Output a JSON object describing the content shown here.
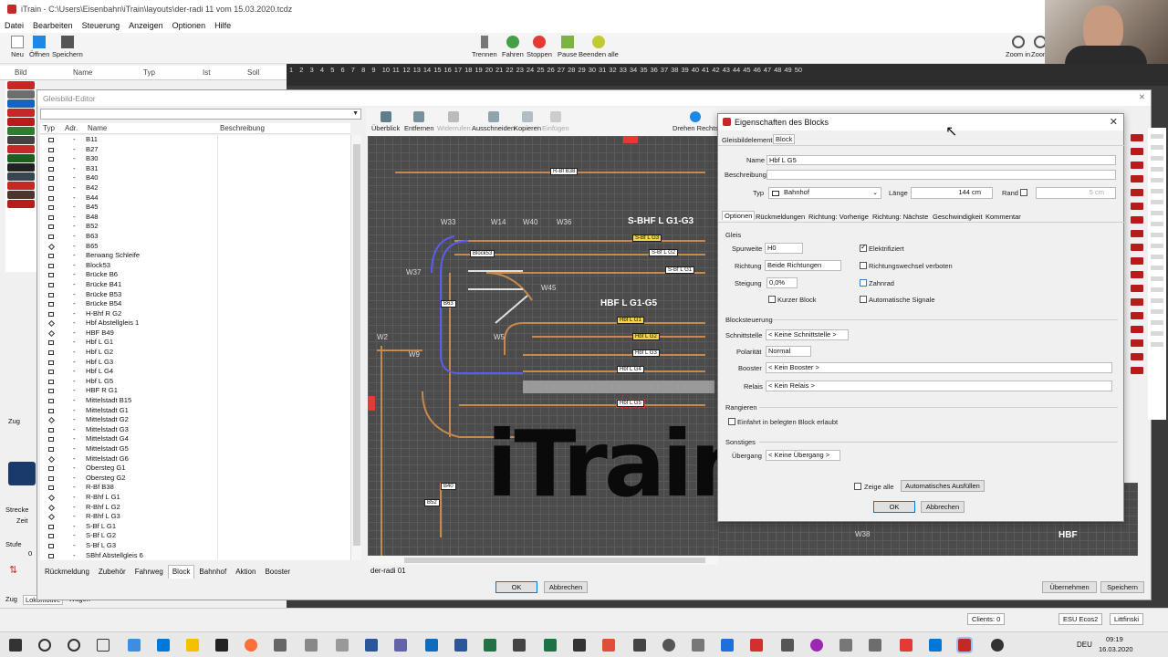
{
  "window": {
    "title": "iTrain - C:\\Users\\Eisenbahn\\iTrain\\layouts\\der-radi 11 vom 15.03.2020.tcdz"
  },
  "menu": [
    "Datei",
    "Bearbeiten",
    "Steuerung",
    "Anzeigen",
    "Optionen",
    "Hilfe"
  ],
  "toolbar": {
    "new": "Neu",
    "open": "Öffnen",
    "save": "Speichern",
    "separate": "Trennen",
    "drive": "Fahren",
    "stop": "Stoppen",
    "pause": "Pause",
    "end_all": "Beenden alle",
    "zoom_in": "Zoom in",
    "zoom_out": "Zoom"
  },
  "loco_header": {
    "bild": "Bild",
    "name": "Name",
    "typ": "Typ",
    "ist": "Ist",
    "soll": "Soll"
  },
  "ruler": [
    "1",
    "2",
    "3",
    "4",
    "5",
    "6",
    "7",
    "8",
    "9",
    "10",
    "11",
    "12",
    "13",
    "14",
    "15",
    "16",
    "17",
    "18",
    "19",
    "20",
    "21",
    "22",
    "23",
    "24",
    "25",
    "26",
    "27",
    "28",
    "29",
    "30",
    "31",
    "32",
    "33",
    "34",
    "35",
    "36",
    "37",
    "38",
    "39",
    "40",
    "41",
    "42",
    "43",
    "44",
    "45",
    "46",
    "47",
    "48",
    "49",
    "50"
  ],
  "editor": {
    "title": "Gleisbild-Editor",
    "columns": {
      "typ": "Typ",
      "adr": "Adr.",
      "name": "Name",
      "desc": "Beschreibung"
    },
    "rows": [
      {
        "t": "b",
        "a": "-",
        "n": "B11"
      },
      {
        "t": "b",
        "a": "-",
        "n": "B27"
      },
      {
        "t": "b",
        "a": "-",
        "n": "B30"
      },
      {
        "t": "b",
        "a": "-",
        "n": "B31"
      },
      {
        "t": "b",
        "a": "-",
        "n": "B40"
      },
      {
        "t": "b",
        "a": "-",
        "n": "B42"
      },
      {
        "t": "b",
        "a": "-",
        "n": "B44"
      },
      {
        "t": "b",
        "a": "-",
        "n": "B45"
      },
      {
        "t": "b",
        "a": "-",
        "n": "B48"
      },
      {
        "t": "b",
        "a": "-",
        "n": "B52"
      },
      {
        "t": "b",
        "a": "-",
        "n": "B63"
      },
      {
        "t": "d",
        "a": "-",
        "n": "B65"
      },
      {
        "t": "b",
        "a": "-",
        "n": "Berwang Schleife"
      },
      {
        "t": "b",
        "a": "-",
        "n": "Block53"
      },
      {
        "t": "b",
        "a": "-",
        "n": "Brücke B6"
      },
      {
        "t": "b",
        "a": "-",
        "n": "Brücke B41"
      },
      {
        "t": "b",
        "a": "-",
        "n": "Brücke B53"
      },
      {
        "t": "b",
        "a": "-",
        "n": "Brücke B54"
      },
      {
        "t": "b",
        "a": "-",
        "n": "H-Bhf R G2"
      },
      {
        "t": "d",
        "a": "-",
        "n": "Hbf Abstellgleis 1"
      },
      {
        "t": "d",
        "a": "-",
        "n": "HBF B49"
      },
      {
        "t": "b",
        "a": "-",
        "n": "Hbf L G1"
      },
      {
        "t": "b",
        "a": "-",
        "n": "Hbf L G2"
      },
      {
        "t": "b",
        "a": "-",
        "n": "Hbf L G3"
      },
      {
        "t": "b",
        "a": "-",
        "n": "Hbf L G4"
      },
      {
        "t": "b",
        "a": "-",
        "n": "Hbf L G5"
      },
      {
        "t": "b",
        "a": "-",
        "n": "HBF R G1"
      },
      {
        "t": "b",
        "a": "-",
        "n": "Mittelstadt B15"
      },
      {
        "t": "b",
        "a": "-",
        "n": "Mittelstadt G1"
      },
      {
        "t": "d",
        "a": "-",
        "n": "Mittelstadt G2"
      },
      {
        "t": "b",
        "a": "-",
        "n": "Mittelstadt G3"
      },
      {
        "t": "b",
        "a": "-",
        "n": "Mittelstadt G4"
      },
      {
        "t": "b",
        "a": "-",
        "n": "Mittelstadt G5"
      },
      {
        "t": "d",
        "a": "-",
        "n": "Mittelstadt G6"
      },
      {
        "t": "b",
        "a": "-",
        "n": "Obersteg G1"
      },
      {
        "t": "b",
        "a": "-",
        "n": "Obersteg G2"
      },
      {
        "t": "b",
        "a": "-",
        "n": "R-Bf B38"
      },
      {
        "t": "d",
        "a": "-",
        "n": "R-Bhf L G1"
      },
      {
        "t": "d",
        "a": "-",
        "n": "R-Bhf L G2"
      },
      {
        "t": "d",
        "a": "-",
        "n": "R-Bhf L G3"
      },
      {
        "t": "b",
        "a": "-",
        "n": "S-Bf L G1"
      },
      {
        "t": "b",
        "a": "-",
        "n": "S-Bf L G2"
      },
      {
        "t": "b",
        "a": "-",
        "n": "S-Bf L G3"
      },
      {
        "t": "b",
        "a": "-",
        "n": "SBhf Abstellgleis 6"
      }
    ],
    "tabs": [
      "Rückmeldung",
      "Zubehör",
      "Fahrweg",
      "Block",
      "Bahnhof",
      "Aktion",
      "Booster"
    ],
    "tools": {
      "overview": "Überblick",
      "remove": "Entfernen",
      "undo": "Widerrufen",
      "cut": "Ausschneiden",
      "copy": "Kopieren",
      "paste": "Einfügen",
      "rotate": "Drehen Rechts"
    },
    "layout_tab": "der-radi 01",
    "ok": "OK",
    "cancel": "Abbrechen",
    "apply": "Übernehmen",
    "save": "Speichern"
  },
  "canvas": {
    "labels": {
      "w33": "W33",
      "w14": "W14",
      "w40": "W40",
      "w36": "W36",
      "w37": "W37",
      "w45": "W45",
      "w5": "W5",
      "w9": "W9",
      "w2": "W2",
      "w38": "W38"
    },
    "big": {
      "sbhf": "S-BHF L G1-G3",
      "hbf": "HBF L G1-G5",
      "hbf2": "HBF"
    },
    "blocks": {
      "rbf": "R-Bf B38",
      "block53": "Block53",
      "b63": "B63",
      "b40": "B40",
      "b52": "B52",
      "sbf3": "S-Bf L G3",
      "sbf2": "S-Bf L G2",
      "sbf1": "S-Bf L G1",
      "hg1": "Hbf L G1",
      "hg2": "Hbf L G2",
      "hg3": "Hbf L G3",
      "hg4": "Hbf L G4",
      "hg5": "Hbf L G5"
    },
    "watermark": "iTrain"
  },
  "dialog": {
    "title": "Eigenschaften des Blocks",
    "tabs_top": [
      "Gleisbildelement",
      "Block"
    ],
    "name_label": "Name",
    "name_value": "Hbf L G5",
    "desc_label": "Beschreibung",
    "desc_value": "",
    "type_label": "Typ",
    "type_value": "Bahnhof",
    "length_label": "Länge",
    "length_value": "144 cm",
    "edge_label": "Rand",
    "edge_value": "5 cm",
    "tabs": [
      "Optionen",
      "Rückmeldungen",
      "Richtung: Vorherige",
      "Richtung: Nächste",
      "Geschwindigkeit",
      "Kommentar"
    ],
    "gleis": "Gleis",
    "gauge_label": "Spurweite",
    "gauge_value": "H0",
    "dir_label": "Richtung",
    "dir_value": "Beide Richtungen",
    "slope_label": "Steigung",
    "slope_value": "0,0%",
    "short_block": "Kurzer Block",
    "electrified": "Elektrifiziert",
    "no_dir_change": "Richtungswechsel verboten",
    "rack": "Zahnrad",
    "auto_signals": "Automatische Signale",
    "block_control": "Blocksteuerung",
    "interface_label": "Schnittstelle",
    "interface_value": "< Keine Schnittstelle >",
    "polarity_label": "Polarität",
    "polarity_value": "Normal",
    "booster_label": "Booster",
    "booster_value": "< Kein Booster >",
    "relay_label": "Relais",
    "relay_value": "< Kein Relais >",
    "shunting": "Rangieren",
    "enter_occupied": "Einfahrt in belegten Block erlaubt",
    "other": "Sonstiges",
    "transition_label": "Übergang",
    "transition_value": "< Keine Übergang >",
    "show_all": "Zeige alle",
    "autofill": "Automatisches Ausfüllen",
    "ok": "OK",
    "cancel": "Abbrechen"
  },
  "side_left": {
    "zug": "Zug",
    "strecke": "Strecke",
    "zeit": "Zeit",
    "stufe": "Stufe",
    "zero": "0",
    "tab1": "Zug",
    "tab2": "Lokomotive",
    "tab3": "Wagen"
  },
  "status": {
    "clients": "Clients: 0",
    "ecos": "ESU Ecos2",
    "user": "Littfinski"
  },
  "taskbar": {
    "lang": "DEU",
    "time": "09:19",
    "date": "16.03.2020"
  }
}
